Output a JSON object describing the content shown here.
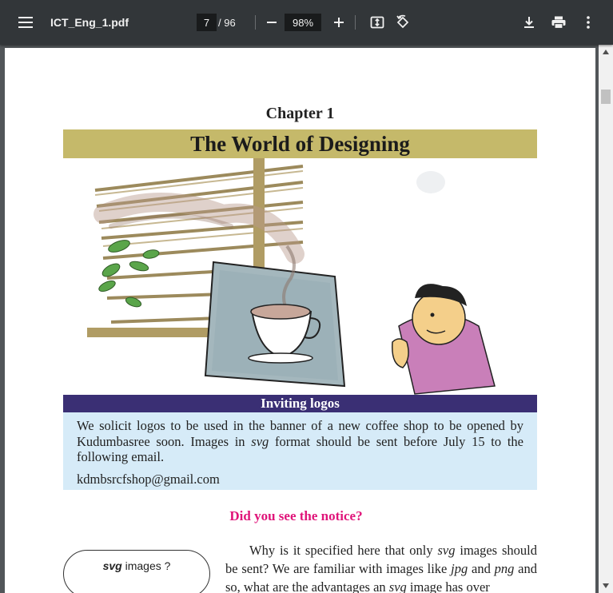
{
  "toolbar": {
    "title": "ICT_Eng_1.pdf",
    "page_current": "7",
    "page_total": "/ 96",
    "zoom": "98%"
  },
  "icons": {
    "menu": "menu-icon",
    "zoom_out": "minus-icon",
    "zoom_in": "plus-icon",
    "fit": "fit-page-icon",
    "rotate": "rotate-icon",
    "download": "download-icon",
    "print": "print-icon",
    "more": "more-vertical-icon"
  },
  "colors": {
    "toolbar": "#323639",
    "title_band": "#c5b96a",
    "notice_head": "#3a2f74",
    "notice_body": "#d6ebf8",
    "question": "#e0157a"
  },
  "document": {
    "chapter": "Chapter 1",
    "title": "The World of Designing",
    "notice": {
      "heading": "Inviting logos",
      "text_1": "We solicit logos to be used in the banner of a new coffee shop to be opened by Kudumbasree soon. Images in ",
      "text_em": "svg",
      "text_2": " format should be sent before July 15 to the following email.",
      "email": "kdmbsrcfshop@gmail.com"
    },
    "question": "Did you see the notice?",
    "bubble": {
      "em": "svg",
      "rest": " images ?"
    },
    "paragraph": {
      "p1": "Why is it specified here that only ",
      "em1": "svg",
      "p2": " images should be sent? We are familiar with images like ",
      "em2": "jpg",
      "p3": " and ",
      "em3": "png",
      "p4": " and so, what are the advantages an ",
      "em4": "svg",
      "p5": " image has over"
    }
  }
}
